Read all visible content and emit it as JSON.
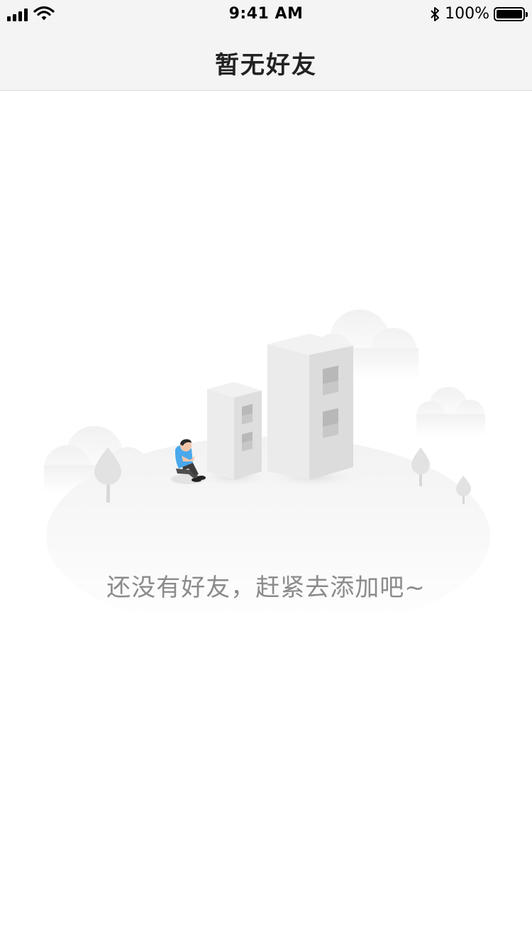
{
  "status_bar": {
    "time": "9:41 AM",
    "battery_percent": "100%",
    "icons": [
      "signal-icon",
      "wifi-icon",
      "bluetooth-icon",
      "battery-icon"
    ]
  },
  "nav": {
    "title": "暂无好友"
  },
  "empty_state": {
    "illustration": "empty-friends-illustration",
    "message": "还没有好友，赶紧去添加吧~"
  },
  "colors": {
    "bar_background": "#f4f4f4",
    "page_background": "#ffffff",
    "title_text": "#222222",
    "message_text": "#8b8b8b",
    "shirt_accent": "#4aa8ec"
  }
}
